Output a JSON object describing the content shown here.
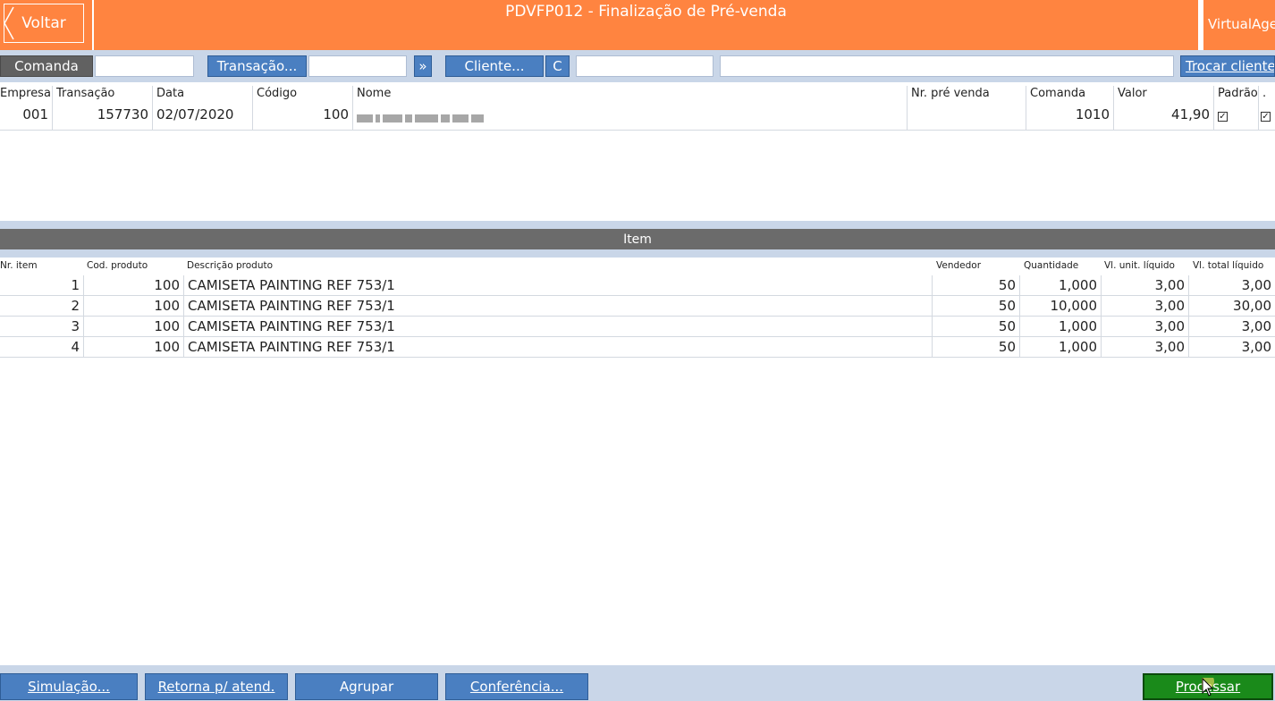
{
  "header": {
    "back_label": "Voltar",
    "title": "PDVFP012 - Finalização de Pré-venda",
    "brand": "VirtualAge"
  },
  "toolbar": {
    "comanda_label": "Comanda",
    "transacao_label": "Transação...",
    "arrow_label": "»",
    "cliente_label": "Cliente...",
    "c_label": "C",
    "trocar_label": "Trocar cliente"
  },
  "sale": {
    "columns": [
      "Empresa",
      "Transação",
      "Data",
      "Código",
      "Nome",
      "Nr. pré venda",
      "Comanda",
      "Valor",
      "Padrão",
      "."
    ],
    "empresa": "001",
    "transacao": "157730",
    "data": "02/07/2020",
    "codigo": "100",
    "nr_pre_venda": "",
    "comanda": "1010",
    "valor": "41,90",
    "padrao_checked": true,
    "extra_checked": true
  },
  "items_section": {
    "title": "Item"
  },
  "items": {
    "columns": [
      "Nr. item",
      "Cod. produto",
      "Descrição produto",
      "Vendedor",
      "Quantidade",
      "Vl. unit. líquido",
      "Vl. total líquido"
    ],
    "rows": [
      {
        "nr": "1",
        "cod": "100",
        "desc": "CAMISETA PAINTING REF 753/1",
        "vend": "50",
        "qtd": "1,000",
        "unit": "3,00",
        "total": "3,00"
      },
      {
        "nr": "2",
        "cod": "100",
        "desc": "CAMISETA PAINTING REF 753/1",
        "vend": "50",
        "qtd": "10,000",
        "unit": "3,00",
        "total": "30,00"
      },
      {
        "nr": "3",
        "cod": "100",
        "desc": "CAMISETA PAINTING REF 753/1",
        "vend": "50",
        "qtd": "1,000",
        "unit": "3,00",
        "total": "3,00"
      },
      {
        "nr": "4",
        "cod": "100",
        "desc": "CAMISETA PAINTING REF 753/1",
        "vend": "50",
        "qtd": "1,000",
        "unit": "3,00",
        "total": "3,00"
      }
    ]
  },
  "footer": {
    "simulacao": "Simulação...",
    "retorna": "Retorna p/ atend.",
    "agrupar": "Agrupar",
    "conferencia": "Conferência...",
    "processar": "Processar"
  },
  "colors": {
    "header_orange": "#ff8440",
    "button_blue": "#4a7fc1",
    "panel_blue": "#c9d6e8",
    "processar_green": "#1a8a1a"
  }
}
